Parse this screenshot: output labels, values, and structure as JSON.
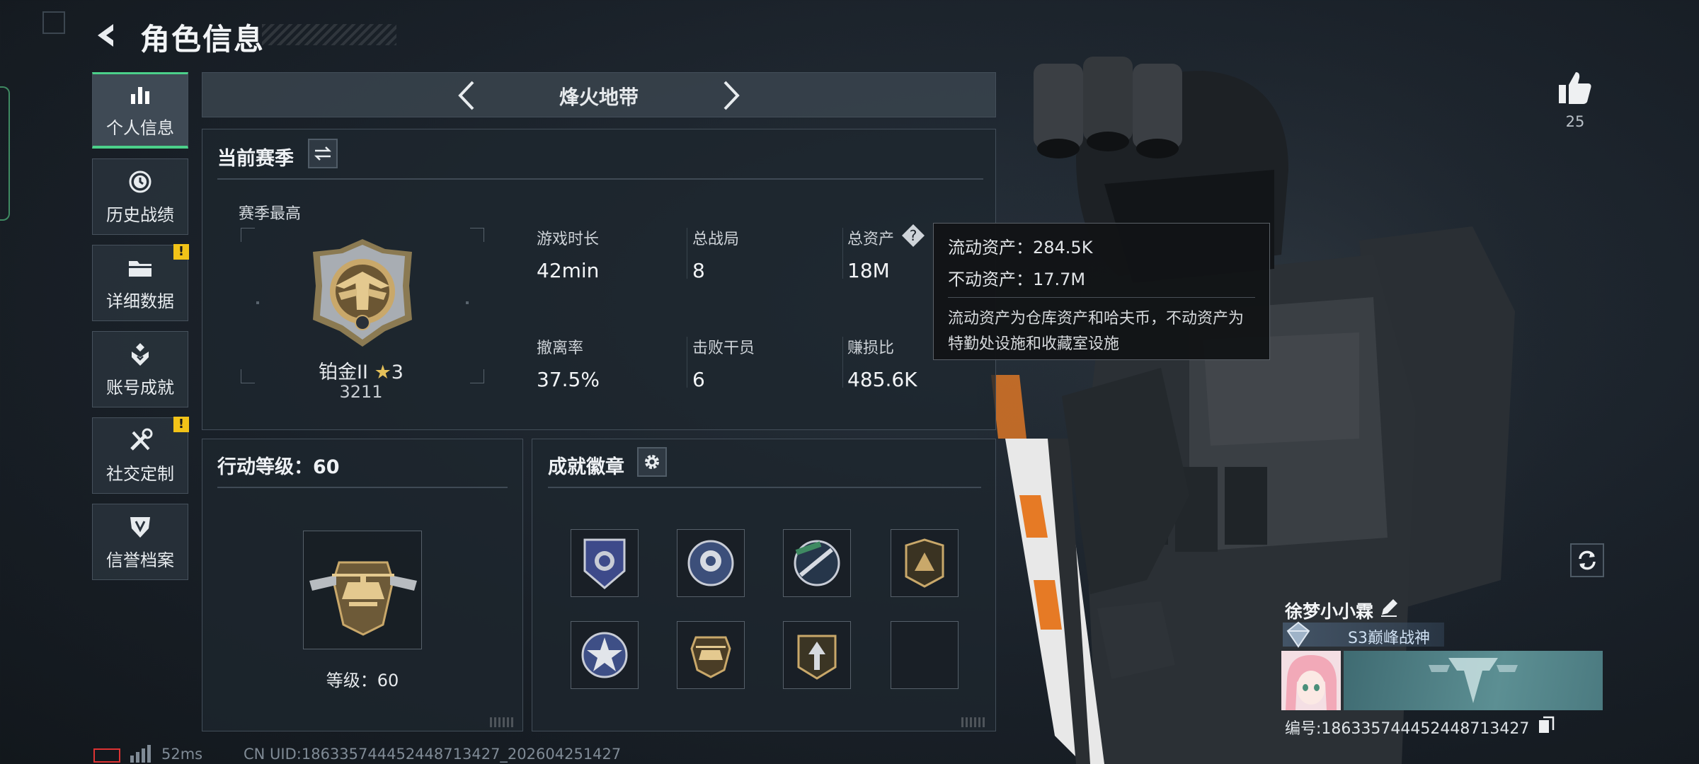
{
  "header": {
    "title": "角色信息"
  },
  "nav": {
    "items": [
      {
        "label": "个人信息",
        "icon": "bar-chart-icon",
        "active": true,
        "alert": false
      },
      {
        "label": "历史战绩",
        "icon": "history-clock-icon",
        "active": false,
        "alert": false
      },
      {
        "label": "详细数据",
        "icon": "folder-icon",
        "active": false,
        "alert": true
      },
      {
        "label": "账号成就",
        "icon": "achievement-icon",
        "active": false,
        "alert": false
      },
      {
        "label": "社交定制",
        "icon": "tools-icon",
        "active": false,
        "alert": true
      },
      {
        "label": "信誉档案",
        "icon": "shield-icon",
        "active": false,
        "alert": false
      }
    ],
    "alert_mark": "!"
  },
  "mode": {
    "title": "烽火地带"
  },
  "season": {
    "title": "当前赛季",
    "best_label": "赛季最高",
    "rank_name": "铂金II",
    "rank_star_glyph": "★",
    "rank_stars": "3",
    "rank_score": "3211",
    "stats": [
      {
        "label": "游戏时长",
        "value": "42min"
      },
      {
        "label": "总战局",
        "value": "8"
      },
      {
        "label": "总资产",
        "value": "18M",
        "help": "?"
      },
      {
        "label": "撤离率",
        "value": "37.5%"
      },
      {
        "label": "击败干员",
        "value": "6"
      },
      {
        "label": "赚损比",
        "value": "485.6K"
      }
    ]
  },
  "tooltip": {
    "liquid": "流动资产：284.5K",
    "fixed": "不动资产：17.7M",
    "desc": "流动资产为仓库资产和哈夫币，不动资产为特勤处设施和收藏室设施"
  },
  "level": {
    "title": "行动等级：60",
    "label": "等级：60"
  },
  "badges": {
    "title": "成就徽章",
    "items": [
      "police-badge-icon",
      "rose-emblem-icon",
      "rifle-emblem-icon",
      "triangle-badge-icon",
      "star-emblem-icon",
      "helicopter-badge-icon",
      "arrow-badge-icon",
      "empty-badge-slot"
    ]
  },
  "likes": {
    "count": "25"
  },
  "profile": {
    "name": "徐梦小小霖",
    "title": "S3巅峰战神",
    "id": "编号:1863357444524487134​27"
  },
  "footer": {
    "ping": "52ms",
    "uid": "CN UID:186335744452448713427_202604251427"
  },
  "colors": {
    "accent_green": "#4bd08a",
    "alert_yellow": "#f2c318",
    "battery_red": "#dd3333"
  }
}
